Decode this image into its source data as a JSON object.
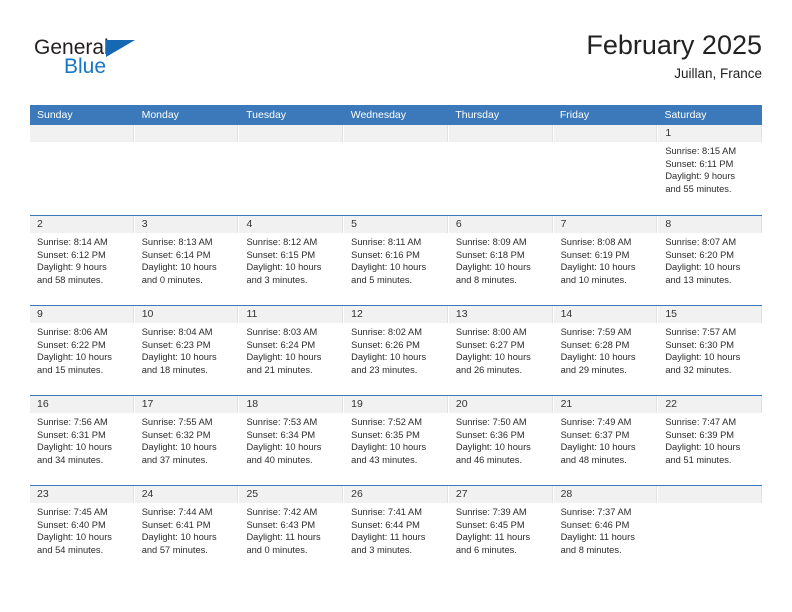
{
  "brand": {
    "name_part1": "General",
    "name_part2": "Blue",
    "triangle_color": "#1668b3",
    "blue_color": "#1877c4"
  },
  "header": {
    "title": "February 2025",
    "location": "Juillan, France",
    "header_bg": "#3b79bb",
    "header_text_color": "#ffffff"
  },
  "weekdays": [
    "Sunday",
    "Monday",
    "Tuesday",
    "Wednesday",
    "Thursday",
    "Friday",
    "Saturday"
  ],
  "weeks": [
    [
      {
        "day": "",
        "lines": []
      },
      {
        "day": "",
        "lines": []
      },
      {
        "day": "",
        "lines": []
      },
      {
        "day": "",
        "lines": []
      },
      {
        "day": "",
        "lines": []
      },
      {
        "day": "",
        "lines": []
      },
      {
        "day": "1",
        "lines": [
          "Sunrise: 8:15 AM",
          "Sunset: 6:11 PM",
          "Daylight: 9 hours",
          "and 55 minutes."
        ]
      }
    ],
    [
      {
        "day": "2",
        "lines": [
          "Sunrise: 8:14 AM",
          "Sunset: 6:12 PM",
          "Daylight: 9 hours",
          "and 58 minutes."
        ]
      },
      {
        "day": "3",
        "lines": [
          "Sunrise: 8:13 AM",
          "Sunset: 6:14 PM",
          "Daylight: 10 hours",
          "and 0 minutes."
        ]
      },
      {
        "day": "4",
        "lines": [
          "Sunrise: 8:12 AM",
          "Sunset: 6:15 PM",
          "Daylight: 10 hours",
          "and 3 minutes."
        ]
      },
      {
        "day": "5",
        "lines": [
          "Sunrise: 8:11 AM",
          "Sunset: 6:16 PM",
          "Daylight: 10 hours",
          "and 5 minutes."
        ]
      },
      {
        "day": "6",
        "lines": [
          "Sunrise: 8:09 AM",
          "Sunset: 6:18 PM",
          "Daylight: 10 hours",
          "and 8 minutes."
        ]
      },
      {
        "day": "7",
        "lines": [
          "Sunrise: 8:08 AM",
          "Sunset: 6:19 PM",
          "Daylight: 10 hours",
          "and 10 minutes."
        ]
      },
      {
        "day": "8",
        "lines": [
          "Sunrise: 8:07 AM",
          "Sunset: 6:20 PM",
          "Daylight: 10 hours",
          "and 13 minutes."
        ]
      }
    ],
    [
      {
        "day": "9",
        "lines": [
          "Sunrise: 8:06 AM",
          "Sunset: 6:22 PM",
          "Daylight: 10 hours",
          "and 15 minutes."
        ]
      },
      {
        "day": "10",
        "lines": [
          "Sunrise: 8:04 AM",
          "Sunset: 6:23 PM",
          "Daylight: 10 hours",
          "and 18 minutes."
        ]
      },
      {
        "day": "11",
        "lines": [
          "Sunrise: 8:03 AM",
          "Sunset: 6:24 PM",
          "Daylight: 10 hours",
          "and 21 minutes."
        ]
      },
      {
        "day": "12",
        "lines": [
          "Sunrise: 8:02 AM",
          "Sunset: 6:26 PM",
          "Daylight: 10 hours",
          "and 23 minutes."
        ]
      },
      {
        "day": "13",
        "lines": [
          "Sunrise: 8:00 AM",
          "Sunset: 6:27 PM",
          "Daylight: 10 hours",
          "and 26 minutes."
        ]
      },
      {
        "day": "14",
        "lines": [
          "Sunrise: 7:59 AM",
          "Sunset: 6:28 PM",
          "Daylight: 10 hours",
          "and 29 minutes."
        ]
      },
      {
        "day": "15",
        "lines": [
          "Sunrise: 7:57 AM",
          "Sunset: 6:30 PM",
          "Daylight: 10 hours",
          "and 32 minutes."
        ]
      }
    ],
    [
      {
        "day": "16",
        "lines": [
          "Sunrise: 7:56 AM",
          "Sunset: 6:31 PM",
          "Daylight: 10 hours",
          "and 34 minutes."
        ]
      },
      {
        "day": "17",
        "lines": [
          "Sunrise: 7:55 AM",
          "Sunset: 6:32 PM",
          "Daylight: 10 hours",
          "and 37 minutes."
        ]
      },
      {
        "day": "18",
        "lines": [
          "Sunrise: 7:53 AM",
          "Sunset: 6:34 PM",
          "Daylight: 10 hours",
          "and 40 minutes."
        ]
      },
      {
        "day": "19",
        "lines": [
          "Sunrise: 7:52 AM",
          "Sunset: 6:35 PM",
          "Daylight: 10 hours",
          "and 43 minutes."
        ]
      },
      {
        "day": "20",
        "lines": [
          "Sunrise: 7:50 AM",
          "Sunset: 6:36 PM",
          "Daylight: 10 hours",
          "and 46 minutes."
        ]
      },
      {
        "day": "21",
        "lines": [
          "Sunrise: 7:49 AM",
          "Sunset: 6:37 PM",
          "Daylight: 10 hours",
          "and 48 minutes."
        ]
      },
      {
        "day": "22",
        "lines": [
          "Sunrise: 7:47 AM",
          "Sunset: 6:39 PM",
          "Daylight: 10 hours",
          "and 51 minutes."
        ]
      }
    ],
    [
      {
        "day": "23",
        "lines": [
          "Sunrise: 7:45 AM",
          "Sunset: 6:40 PM",
          "Daylight: 10 hours",
          "and 54 minutes."
        ]
      },
      {
        "day": "24",
        "lines": [
          "Sunrise: 7:44 AM",
          "Sunset: 6:41 PM",
          "Daylight: 10 hours",
          "and 57 minutes."
        ]
      },
      {
        "day": "25",
        "lines": [
          "Sunrise: 7:42 AM",
          "Sunset: 6:43 PM",
          "Daylight: 11 hours",
          "and 0 minutes."
        ]
      },
      {
        "day": "26",
        "lines": [
          "Sunrise: 7:41 AM",
          "Sunset: 6:44 PM",
          "Daylight: 11 hours",
          "and 3 minutes."
        ]
      },
      {
        "day": "27",
        "lines": [
          "Sunrise: 7:39 AM",
          "Sunset: 6:45 PM",
          "Daylight: 11 hours",
          "and 6 minutes."
        ]
      },
      {
        "day": "28",
        "lines": [
          "Sunrise: 7:37 AM",
          "Sunset: 6:46 PM",
          "Daylight: 11 hours",
          "and 8 minutes."
        ]
      },
      {
        "day": "",
        "lines": []
      }
    ]
  ]
}
